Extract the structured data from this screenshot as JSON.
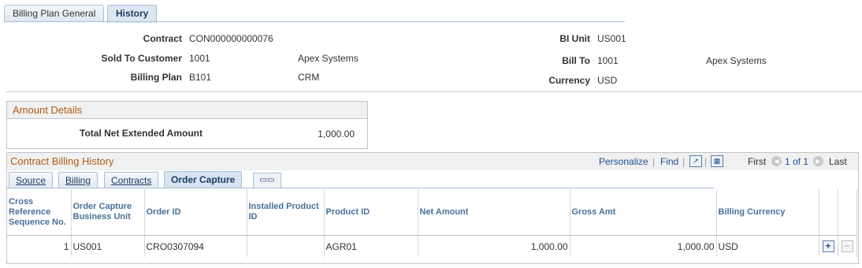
{
  "page_tabs": [
    {
      "label": "Billing Plan General",
      "active": false
    },
    {
      "label": "History",
      "active": true
    }
  ],
  "header": {
    "contract": {
      "label": "Contract",
      "value": "CON000000000076"
    },
    "sold_to": {
      "label": "Sold To Customer",
      "value": "1001",
      "name": "Apex Systems"
    },
    "billing_plan": {
      "label": "Billing Plan",
      "value": "B101",
      "desc": "CRM"
    },
    "bi_unit": {
      "label": "BI Unit",
      "value": "US001"
    },
    "bill_to": {
      "label": "Bill To",
      "value": "1001",
      "name": "Apex Systems"
    },
    "currency": {
      "label": "Currency",
      "value": "USD"
    }
  },
  "amount_details": {
    "title": "Amount Details",
    "total_label": "Total Net Extended Amount",
    "total_value": "1,000.00"
  },
  "history": {
    "title": "Contract Billing History",
    "personalize": "Personalize",
    "find": "Find",
    "first": "First",
    "range": "1 of 1",
    "last": "Last",
    "sub_tabs": [
      {
        "label": "Source",
        "active": false
      },
      {
        "label": "Billing",
        "active": false
      },
      {
        "label": "Contracts",
        "active": false
      },
      {
        "label": "Order Capture",
        "active": true
      }
    ],
    "columns": {
      "xref": "Cross Reference Sequence No.",
      "oc_bu": "Order Capture Business Unit",
      "order_id": "Order ID",
      "installed": "Installed Product ID",
      "product": "Product ID",
      "net": "Net Amount",
      "gross": "Gross Amt",
      "currency": "Billing Currency"
    },
    "rows": [
      {
        "xref": "1",
        "oc_bu": "US001",
        "order_id": "CRO0307094",
        "installed": "",
        "product": "AGR01",
        "net": "1,000.00",
        "gross": "1,000.00",
        "currency": "USD"
      }
    ],
    "add_symbol": "+",
    "delete_symbol": "−"
  },
  "colors": {
    "section_title": "#b05a16",
    "link": "#1f4e94",
    "column_header": "#4a6f9a"
  }
}
